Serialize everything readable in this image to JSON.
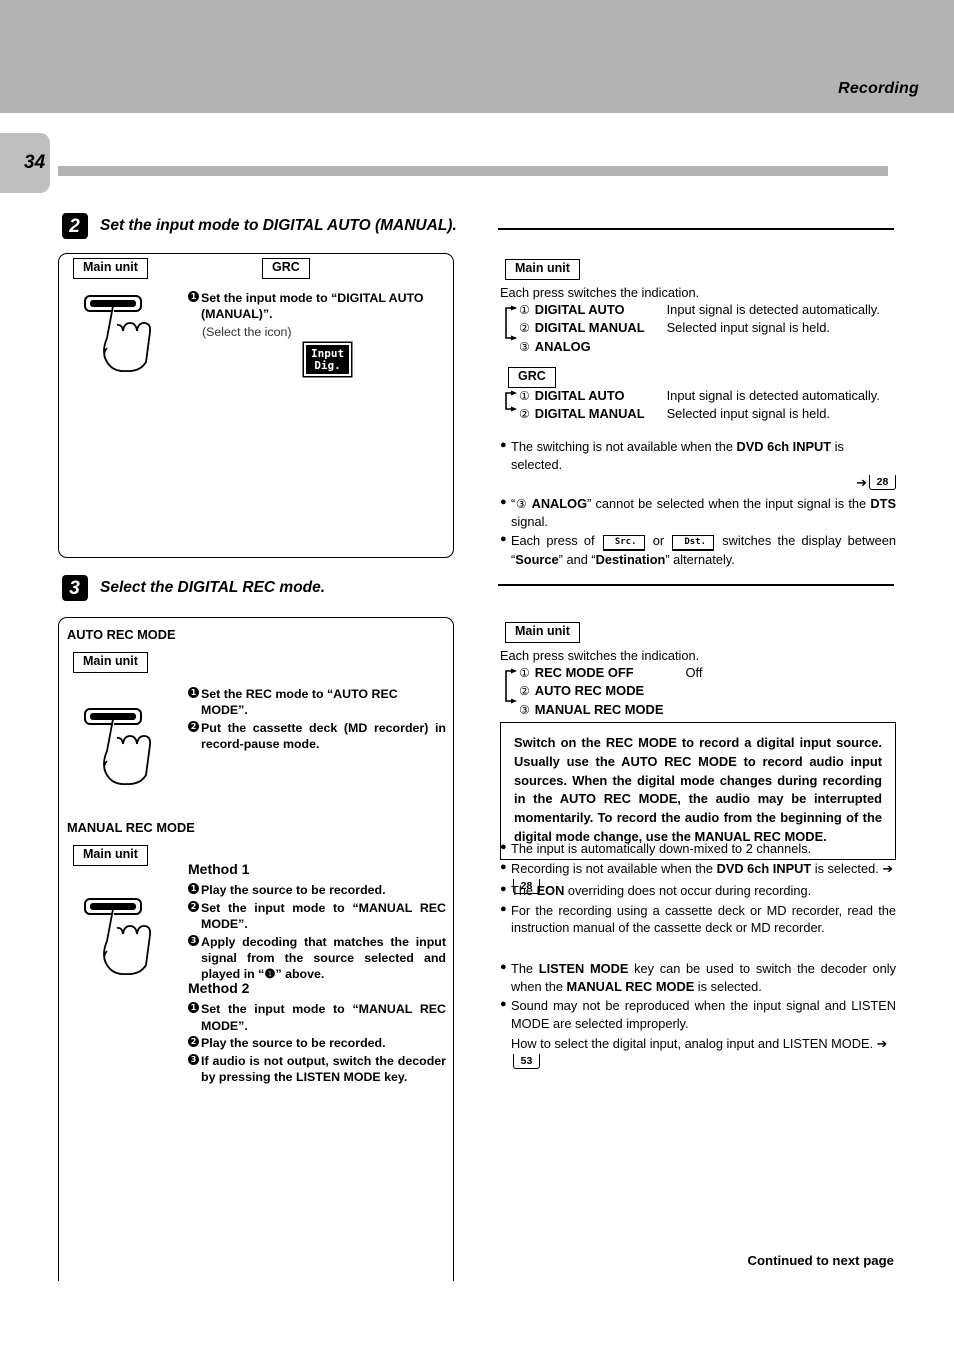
{
  "header": {
    "section_title": "Recording",
    "page_number": "34"
  },
  "step2": {
    "badge": "2",
    "title": "Set the input mode to DIGITAL AUTO (MANUAL).",
    "left_box": {
      "tag_main_unit": "Main unit",
      "tag_grc": "GRC",
      "items": [
        {
          "marker": "1",
          "text": "Set the input mode to “DIGITAL AUTO (MANUAL)”."
        }
      ],
      "sub_note": "(Select the icon)",
      "lcd_line1": "Input",
      "lcd_line2": "Dig."
    },
    "right": {
      "tag_main_unit": "Main unit",
      "each_press": "Each press switches the indication.",
      "main_unit_sequence": [
        {
          "num": "①",
          "label": "DIGITAL AUTO",
          "desc": "Input signal is detected automatically."
        },
        {
          "num": "②",
          "label": "DIGITAL MANUAL",
          "desc": "Selected input signal is held."
        },
        {
          "num": "③",
          "label": "ANALOG",
          "desc": ""
        }
      ],
      "tag_grc": "GRC",
      "grc_sequence": [
        {
          "num": "①",
          "label": "DIGITAL AUTO",
          "desc": "Input signal is detected automatically."
        },
        {
          "num": "②",
          "label": "DIGITAL MANUAL",
          "desc": "Selected input signal is held."
        }
      ],
      "bullets": [
        {
          "id": "b1",
          "pre": "The switching is not available when the ",
          "bold": "DVD 6ch INPUT",
          "post": " is selected.",
          "pageref": "28"
        },
        {
          "id": "b2",
          "text": "“③ ANALOG” cannot be selected when the input signal is the DTS signal."
        },
        {
          "id": "b3",
          "text": "Each press of Src. or Dst. switches the display between “Source” and “Destination” alternately.",
          "key1": "Src.",
          "key2": "Dst."
        }
      ]
    }
  },
  "step3": {
    "badge": "3",
    "title": "Select the DIGITAL REC mode.",
    "left_box": {
      "auto_heading": "AUTO REC MODE",
      "auto_tag_main_unit": "Main unit",
      "auto_items": [
        {
          "marker": "1",
          "text": "Set the REC mode to “AUTO REC MODE”."
        },
        {
          "marker": "2",
          "text": "Put the cassette deck (MD recorder) in record-pause mode."
        }
      ],
      "manual_heading": "MANUAL REC MODE",
      "manual_tag_main_unit": "Main unit",
      "method1_heading": "Method 1",
      "method1_items": [
        {
          "marker": "1",
          "text": "Play the source to be recorded."
        },
        {
          "marker": "2",
          "text": "Set the input mode to “MANUAL REC MODE”."
        },
        {
          "marker": "3",
          "text": "Apply decoding that matches the input signal from the source selected and played in “❶” above."
        }
      ],
      "method2_heading": "Method 2",
      "method2_items": [
        {
          "marker": "1",
          "text": "Set the input mode to “MANUAL REC MODE”."
        },
        {
          "marker": "2",
          "text": "Play the source to be recorded."
        },
        {
          "marker": "3",
          "text": "If audio is not output, switch the decoder by pressing the LISTEN MODE key."
        }
      ]
    },
    "right": {
      "tag_main_unit": "Main unit",
      "each_press": "Each press switches the indication.",
      "sequence": [
        {
          "num": "①",
          "label": "REC MODE OFF",
          "desc": "Off"
        },
        {
          "num": "②",
          "label": "AUTO REC MODE",
          "desc": ""
        },
        {
          "num": "③",
          "label": "MANUAL REC MODE",
          "desc": ""
        }
      ],
      "callout": "Switch on the REC MODE to record a digital input source. Usually use the AUTO REC MODE to record audio input sources. When the digital mode changes during recording in the AUTO REC MODE, the audio may be interrupted momentarily. To record the audio from the beginning of the digital mode change, use the MANUAL REC MODE.",
      "bullets_a": [
        {
          "text": "The input is automatically down-mixed to 2 channels."
        },
        {
          "pre": "Recording is not available when the ",
          "bold": "DVD 6ch INPUT",
          "post": " is selected.",
          "pageref": "28"
        }
      ],
      "bullets_b": [
        {
          "pre": "The ",
          "bold": "EON",
          "post": " overriding does not occur during recording."
        },
        {
          "text": "For the recording using a cassette deck or MD recorder, read the instruction manual of the cassette deck or MD recorder."
        }
      ],
      "bullets_c": [
        {
          "pre": "The ",
          "bold": "LISTEN MODE",
          "mid": " key can be used to switch the decoder only when the ",
          "bold2": "MANUAL REC MODE",
          "post": " is selected."
        },
        {
          "text": "Sound may not be reproduced when the input signal and LISTEN MODE are selected improperly."
        }
      ],
      "howto": "How to select the digital input, analog input and LISTEN MODE.",
      "howto_pageref": "53"
    }
  },
  "footer": {
    "continued": "Continued to next page"
  }
}
